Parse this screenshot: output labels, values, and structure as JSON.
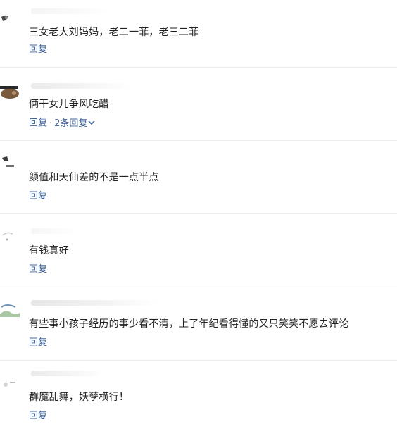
{
  "comments": [
    {
      "text": "三女老大刘妈妈，老二一菲，老三二菲",
      "reply_label": "回复"
    },
    {
      "text": "俩干女儿争风吃醋",
      "reply_label": "回复",
      "replies_label": "2条回复"
    },
    {
      "text": "颜值和天仙差的不是一点半点",
      "reply_label": "回复"
    },
    {
      "text": "有钱真好",
      "reply_label": "回复"
    },
    {
      "text": "有些事小孩子经历的事少看不清，上了年纪看得懂的又只笑笑不愿去评论",
      "reply_label": "回复"
    },
    {
      "text": "群魔乱舞，妖孽横行！",
      "reply_label": "回复"
    }
  ],
  "separator": "·",
  "colors": {
    "link": "#406599",
    "text": "#222222",
    "divider": "#ebebeb"
  },
  "icons": {
    "expand": "chevron-down-icon"
  }
}
